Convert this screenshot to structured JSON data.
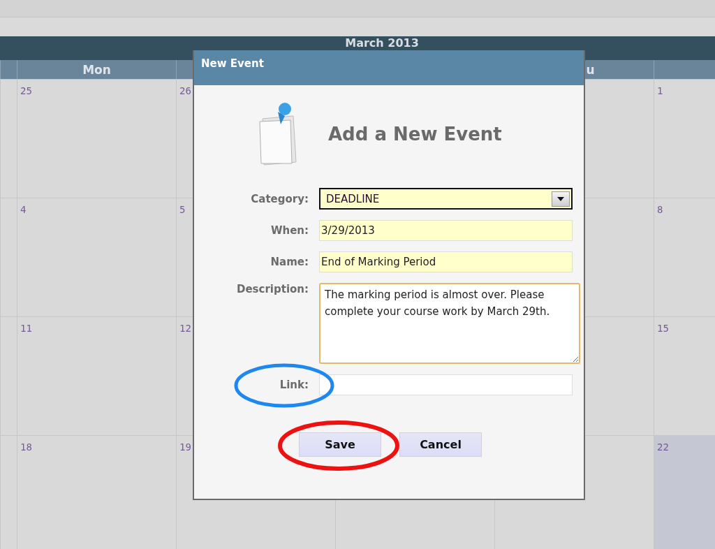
{
  "calendar": {
    "title": "March 2013",
    "headers": [
      "Mon",
      "u"
    ],
    "weeks": [
      [
        {
          "day": "25",
          "selected": false
        },
        {
          "day": "26",
          "selected": false
        },
        {
          "day": "1",
          "selected": false
        }
      ],
      [
        {
          "day": "4",
          "selected": false
        },
        {
          "day": "5",
          "selected": false
        },
        {
          "day": "8",
          "selected": false
        }
      ],
      [
        {
          "day": "11",
          "selected": false
        },
        {
          "day": "12",
          "selected": false
        },
        {
          "day": "15",
          "selected": false
        }
      ],
      [
        {
          "day": "18",
          "selected": false
        },
        {
          "day": "19",
          "selected": false
        },
        {
          "day": "22",
          "selected": true
        }
      ]
    ]
  },
  "dialog": {
    "title": "New Event",
    "heading": "Add a New Event",
    "fields": [
      {
        "kind": "select",
        "label": "Category:",
        "value": "DEADLINE"
      },
      {
        "kind": "text",
        "label": "When:",
        "value": "3/29/2013"
      },
      {
        "kind": "text",
        "label": "Name:",
        "value": "End of Marking Period"
      },
      {
        "kind": "textarea",
        "label": "Description:",
        "value": "The marking period is almost over. Please complete your course work by March 29th."
      },
      {
        "kind": "link",
        "label": "Link:"
      }
    ],
    "buttons": [
      "Save",
      "Cancel"
    ]
  }
}
